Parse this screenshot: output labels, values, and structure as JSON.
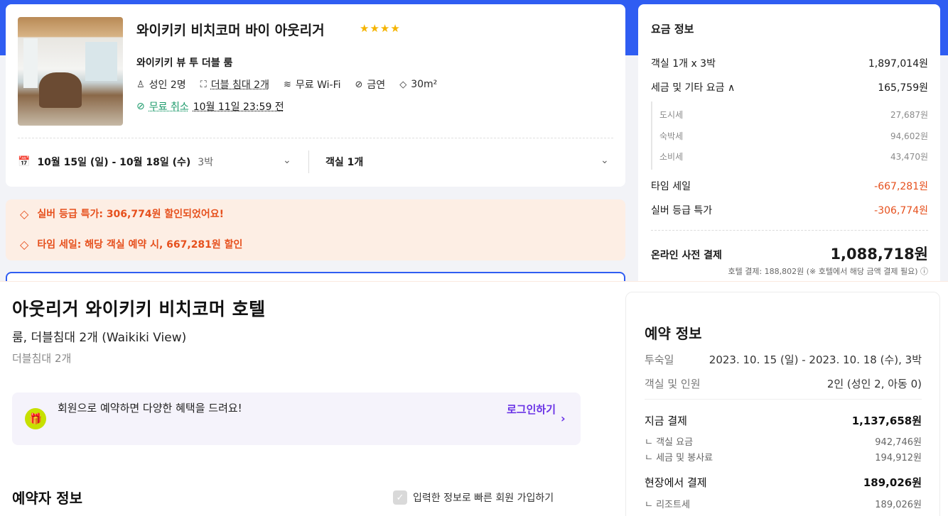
{
  "agoda": {
    "hotel_name": "와이키키 비치코머 바이 아웃리거",
    "stars": "★★★★",
    "room_name": "와이키키 뷰 투 더블 룸",
    "amenities": [
      "성인 2명",
      "더블 침대 2개",
      "무료 Wi-Fi",
      "금연",
      "30m²"
    ],
    "cancel_free": "무료 취소",
    "cancel_deadline": "10월 11일 23:59 전",
    "dates": "10월 15일 (일) - 10월 18일 (수)",
    "nights": "3박",
    "rooms": "객실 1개",
    "promo1": "실버 등급 특가: 306,774원 할인되었어요!",
    "promo2": "타임 세일: 해당 객실 예약 시, 667,281원 할인",
    "price": {
      "title": "요금 정보",
      "rooms_label": "객실 1개 x 3박",
      "rooms_value": "1,897,014원",
      "tax_label": "세금 및 기타 요금 ∧",
      "tax_value": "165,759원",
      "city_tax_label": "도시세",
      "city_tax_value": "27,687원",
      "lodging_tax_label": "숙박세",
      "lodging_tax_value": "94,602원",
      "consumption_tax_label": "소비세",
      "consumption_tax_value": "43,470원",
      "time_sale_label": "타임 세일",
      "time_sale_value": "-667,281원",
      "silver_label": "실버 등급 특가",
      "silver_value": "-306,774원",
      "total_label": "온라인 사전 결제",
      "total_value": "1,088,718원",
      "hotel_pay_note": "호텔 결제: 188,802원 (※ 호텔에서 해당 금액 결제 필요) ⓘ"
    }
  },
  "yanolja": {
    "hotel_name": "아웃리거 와이키키 비치코머 호텔",
    "room_desc": "룸, 더블침대 2개 (Waikiki View)",
    "bed_desc": "더블침대 2개",
    "member_text": "회원으로 예약하면 다양한 혜택을 드려요!",
    "login_label": "로그인하기",
    "booker_title": "예약자 정보",
    "quick_join": "입력한 정보로 빠른 회원 가입하기",
    "resv": {
      "title": "예약 정보",
      "stay_label": "투숙일",
      "stay_value": "2023. 10. 15 (일) - 2023. 10. 18 (수), 3박",
      "guests_label": "객실 및 인원",
      "guests_value": "2인 (성인 2, 아동 0)",
      "pay_now_label": "지금 결제",
      "pay_now_value": "1,137,658원",
      "room_fee_label": "ㄴ 객실 요금",
      "room_fee_value": "942,746원",
      "tax_service_label": "ㄴ 세금 및 봉사료",
      "tax_service_value": "194,912원",
      "pay_onsite_label": "현장에서 결제",
      "pay_onsite_value": "189,026원",
      "resort_label": "ㄴ 리조트세",
      "resort_value": "189,026원"
    }
  }
}
